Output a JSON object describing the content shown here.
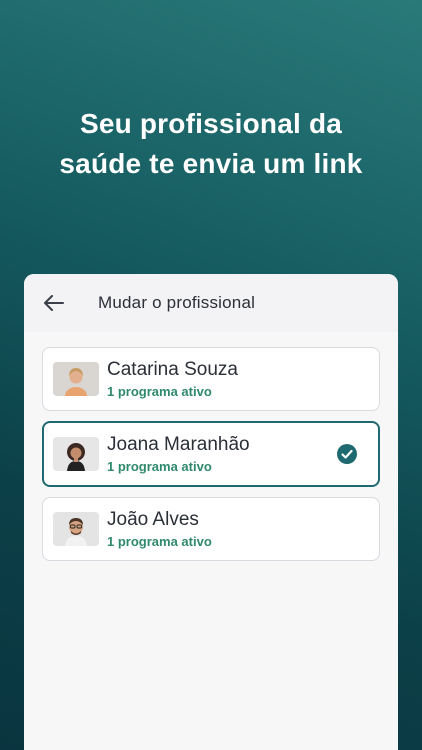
{
  "headline": {
    "line1": "Seu profissional da",
    "line2": "saúde te envia um link"
  },
  "card": {
    "title": "Mudar o profissional",
    "back_icon": "arrow-left-icon"
  },
  "professionals": [
    {
      "name": "Catarina Souza",
      "subtitle": "1 programa ativo",
      "selected": false
    },
    {
      "name": "Joana Maranhão",
      "subtitle": "1 programa ativo",
      "selected": true
    },
    {
      "name": "João Alves",
      "subtitle": "1 programa ativo",
      "selected": false
    }
  ],
  "colors": {
    "accent": "#1f6a70",
    "subtitle": "#2f8a6a",
    "background_top": "#2a7a7a",
    "background_bottom": "#0a3540"
  }
}
